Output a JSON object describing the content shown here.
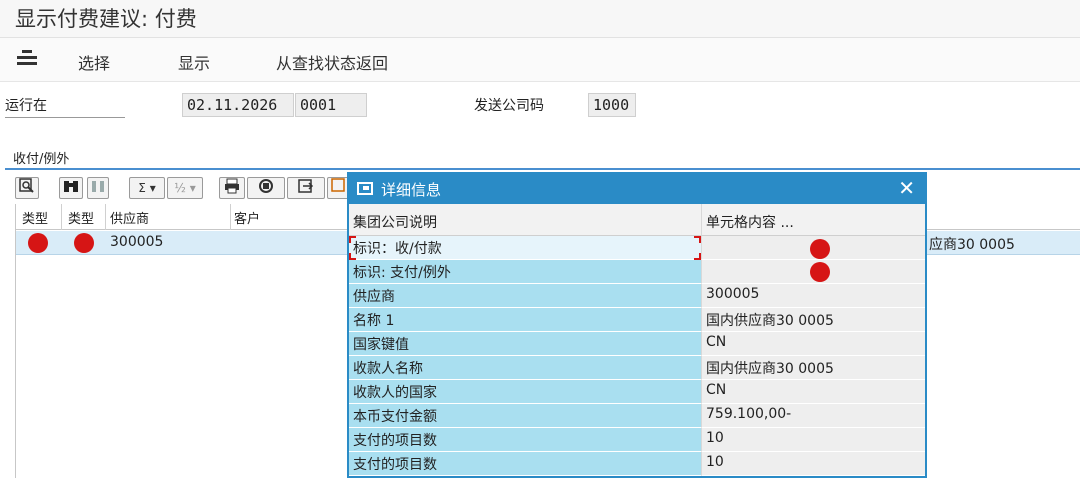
{
  "title": "显示付费建议: 付费",
  "toolbar": {
    "select": "选择",
    "display": "显示",
    "back_from_search": "从查找状态返回"
  },
  "fields": {
    "run_on_label": "运行在",
    "run_date": "02.11.2026",
    "run_id": "0001",
    "company_code_label": "发送公司码",
    "company_code": "1000"
  },
  "group_label": "收付/例外",
  "alv_toolbar": {
    "sum_label": "Σ",
    "subtotal_label": "½"
  },
  "grid": {
    "headers": [
      "类型",
      "类型",
      "供应商",
      "客户"
    ],
    "row": {
      "vendor": "300005",
      "right_text": "应商30 0005"
    }
  },
  "dialog": {
    "title": "详细信息",
    "col1": "集团公司说明",
    "col2": "单元格内容 ...",
    "rows": [
      {
        "label": "标识：收/付款",
        "value": ""
      },
      {
        "label": "标识: 支付/例外",
        "value": ""
      },
      {
        "label": "供应商",
        "value": "300005"
      },
      {
        "label": "名称 1",
        "value": "国内供应商30 0005"
      },
      {
        "label": "国家键值",
        "value": "CN"
      },
      {
        "label": "收款人名称",
        "value": "国内供应商30 0005"
      },
      {
        "label": "收款人的国家",
        "value": "CN"
      },
      {
        "label": "本币支付金额",
        "value": "759.100,00-"
      },
      {
        "label": "支付的项目数",
        "value": "10"
      },
      {
        "label": "支付的项目数",
        "value": "10"
      }
    ]
  },
  "colors": {
    "accent": "#2a8bc6",
    "status_red": "#d61515",
    "row_highlight": "#d9ecf8",
    "dialog_label_bg": "#a9dff0"
  },
  "icons": [
    "menu-icon",
    "find-icon",
    "binoculars-icon",
    "sum-icon",
    "print-icon",
    "export-icon",
    "close-icon",
    "details-icon"
  ]
}
